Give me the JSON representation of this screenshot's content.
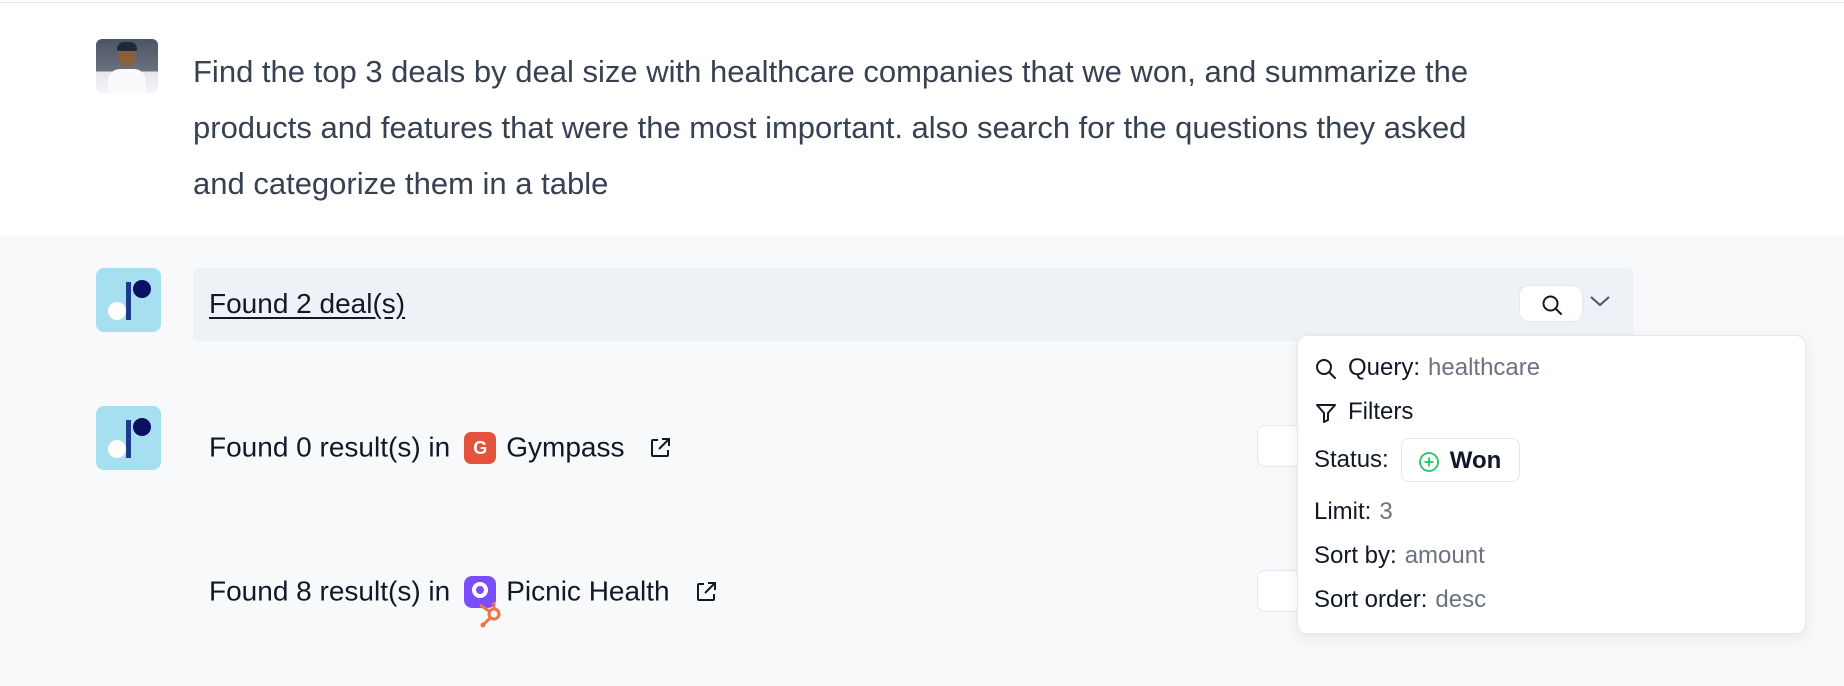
{
  "user_message": {
    "text": "Find the top 3 deals by deal size with healthcare companies that we won, and summarize the products and features that were the most important. also search for the questions they asked and categorize them in a table"
  },
  "deals_card": {
    "title": "Found 2 deal(s)",
    "search_icon": "search-icon",
    "expand_icon": "chevron-down-icon"
  },
  "results": [
    {
      "prefix": "Found 0 result(s) in",
      "company": "Gympass",
      "logo_letter": "G",
      "logo_color": "#e3533c"
    },
    {
      "prefix": "Found 8 result(s) in",
      "company": "Picnic Health",
      "logo_color": "#7c4dff",
      "badge_color": "#f27244"
    }
  ],
  "popover": {
    "query_label": "Query:",
    "query_value": "healthcare",
    "filters_label": "Filters",
    "status_label": "Status:",
    "status_value": "Won",
    "status_color": "#22c55e",
    "limit_label": "Limit:",
    "limit_value": "3",
    "sort_by_label": "Sort by:",
    "sort_by_value": "amount",
    "sort_order_label": "Sort order:",
    "sort_order_value": "desc"
  }
}
